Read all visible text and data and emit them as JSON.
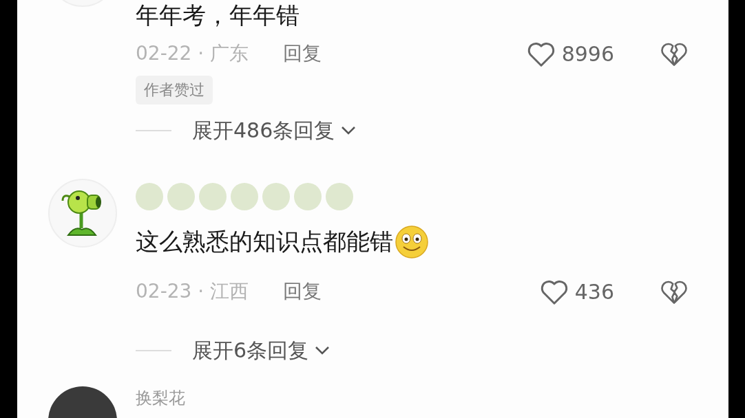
{
  "comments": [
    {
      "kind": "blank",
      "text": "年年考，年年错",
      "emoji": false,
      "date": "02-22",
      "separator": "·",
      "region": "广东",
      "reply": "回复",
      "likes": "8996",
      "badge": "作者赞过",
      "expand": "展开486条回复"
    },
    {
      "kind": "plant",
      "name_redacted": true,
      "text": "这么熟悉的知识点都能错",
      "emoji": true,
      "date": "02-23",
      "separator": "·",
      "region": "江西",
      "reply": "回复",
      "likes": "436",
      "expand": "展开6条回复"
    },
    {
      "kind": "photo",
      "name_redacted": false,
      "name": "换梨花"
    }
  ]
}
